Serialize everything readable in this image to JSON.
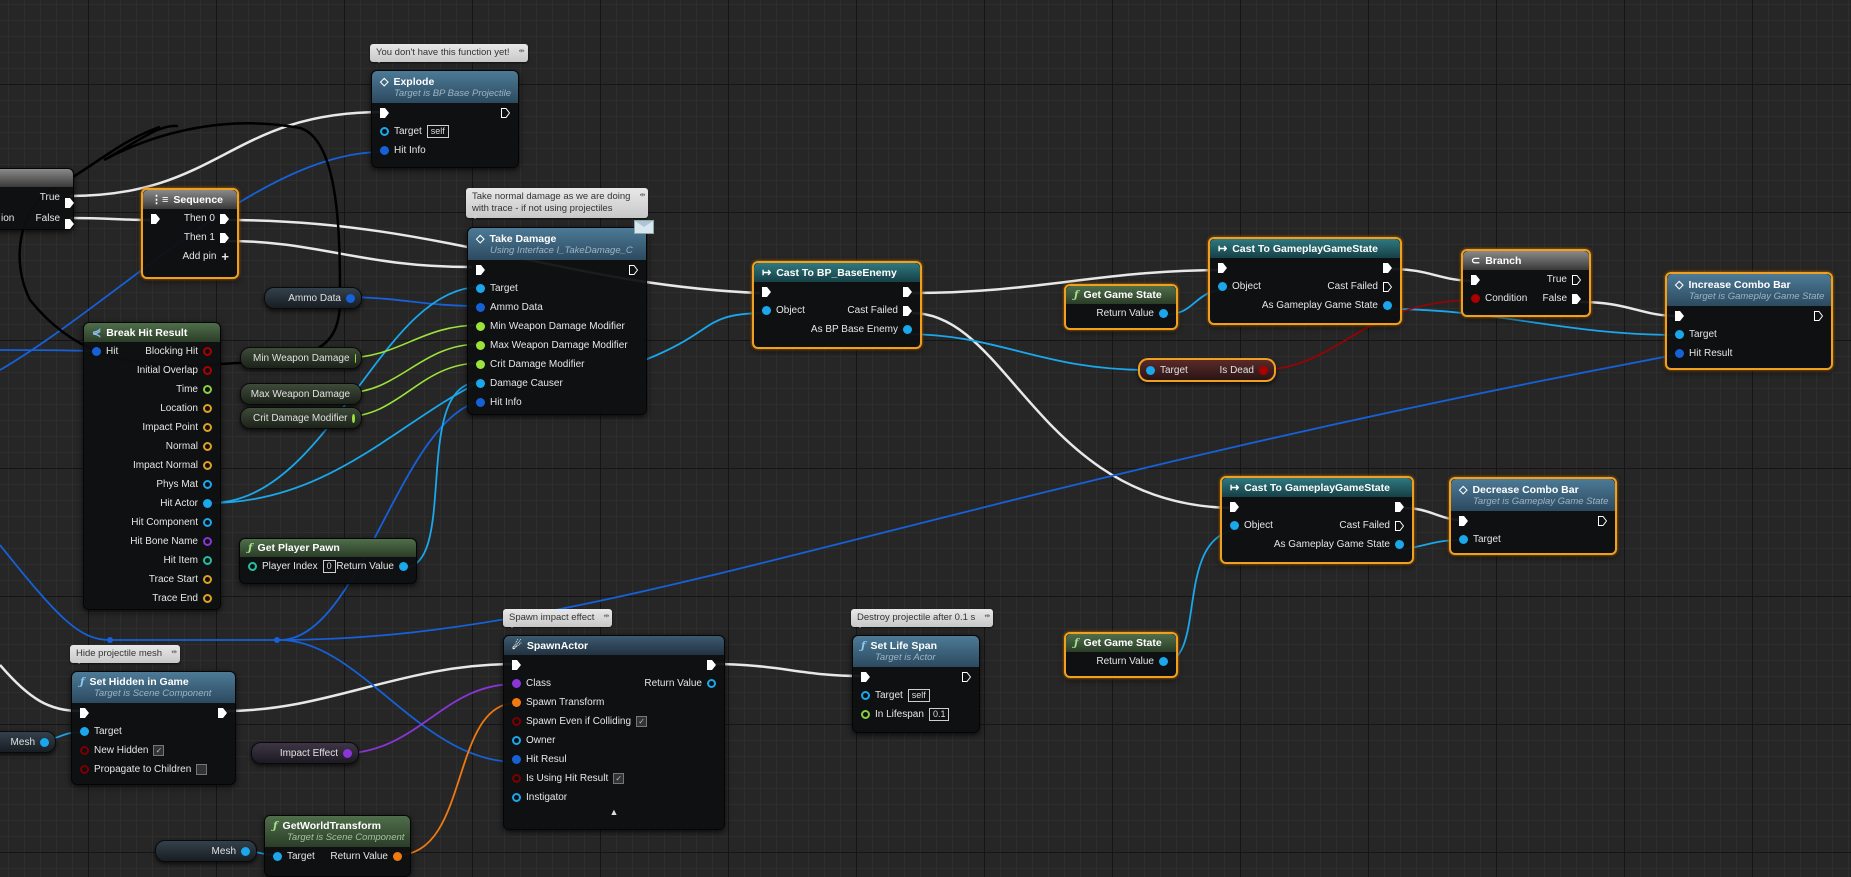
{
  "app": "Unreal Engine Blueprint Graph Editor",
  "colors": {
    "exec": "#ffffff",
    "object": "#1aa7ec",
    "struct": "#1660d8",
    "float": "#9be33a",
    "bool": "#a00000",
    "vector": "#e0a020",
    "class": "#8a35d8",
    "transform": "#f07a10",
    "selection": "#f0a020"
  },
  "comments": {
    "explode": "You don't have this function yet!",
    "take_damage": [
      "Take normal damage as we are doing",
      "with trace - if not using projectiles"
    ],
    "hide_mesh": "Hide projectile mesh",
    "spawn": "Spawn impact effect",
    "destroy": "Destroy projectile after 0.1 s"
  },
  "nodes": {
    "partial_branch": {
      "true": "True",
      "false": "False",
      "condition_fragment": "ion"
    },
    "sequence": {
      "title": "Sequence",
      "then0": "Then 0",
      "then1": "Then 1",
      "add_pin": "Add pin"
    },
    "explode": {
      "title": "Explode",
      "subtitle": "Target is BP Base Projectile",
      "target": "Target",
      "target_default": "self",
      "hit_info": "Hit Info"
    },
    "take_damage": {
      "title": "Take Damage",
      "subtitle": "Using Interface I_TakeDamage_C",
      "pins": [
        "Target",
        "Ammo Data",
        "Min Weapon Damage Modifier",
        "Max Weapon Damage Modifier",
        "Crit Damage Modifier",
        "Damage Causer",
        "Hit Info"
      ]
    },
    "break_hit_result": {
      "title": "Break Hit Result",
      "input": "Hit",
      "outputs": [
        "Blocking Hit",
        "Initial Overlap",
        "Time",
        "Location",
        "Impact Point",
        "Normal",
        "Impact Normal",
        "Phys Mat",
        "Hit Actor",
        "Hit Component",
        "Hit Bone Name",
        "Hit Item",
        "Trace Start",
        "Trace End"
      ]
    },
    "get_player_pawn": {
      "title": "Get Player Pawn",
      "player_index": "Player Index",
      "player_index_value": "0",
      "return_value": "Return Value"
    },
    "cast_base_enemy": {
      "title": "Cast To BP_BaseEnemy",
      "object": "Object",
      "cast_failed": "Cast Failed",
      "as": "As BP Base Enemy"
    },
    "get_game_state_1": {
      "title": "Get Game State",
      "return_value": "Return Value"
    },
    "cast_game_state_1": {
      "title": "Cast To GameplayGameState",
      "object": "Object",
      "cast_failed": "Cast Failed",
      "as": "As Gameplay Game State"
    },
    "is_dead": {
      "target": "Target",
      "label": "Is Dead"
    },
    "branch": {
      "title": "Branch",
      "true": "True",
      "false": "False",
      "condition": "Condition"
    },
    "increase_combo": {
      "title": "Increase Combo Bar",
      "subtitle": "Target is Gameplay Game State",
      "target": "Target",
      "hit_result": "Hit Result"
    },
    "cast_game_state_2": {
      "title": "Cast To GameplayGameState",
      "object": "Object",
      "cast_failed": "Cast Failed",
      "as": "As Gameplay Game State"
    },
    "decrease_combo": {
      "title": "Decrease Combo Bar",
      "subtitle": "Target is Gameplay Game State",
      "target": "Target"
    },
    "get_game_state_2": {
      "title": "Get Game State",
      "return_value": "Return Value"
    },
    "set_hidden": {
      "title": "Set Hidden in Game",
      "subtitle": "Target is Scene Component",
      "target": "Target",
      "new_hidden": "New Hidden",
      "new_hidden_checked": true,
      "propagate": "Propagate to Children",
      "propagate_checked": false
    },
    "spawn_actor": {
      "title": "SpawnActor",
      "class": "Class",
      "return_value": "Return Value",
      "spawn_transform": "Spawn Transform",
      "spawn_even": "Spawn Even if Colliding",
      "owner": "Owner",
      "hit_resul": "Hit Resul",
      "is_using": "Is Using Hit Result",
      "instigator": "Instigator"
    },
    "set_life_span": {
      "title": "Set Life Span",
      "subtitle": "Target is Actor",
      "target": "Target",
      "target_default": "self",
      "lifespan": "In Lifespan",
      "lifespan_value": "0.1"
    },
    "get_world_transform": {
      "title": "GetWorldTransform",
      "subtitle": "Target is Scene Component",
      "target": "Target",
      "return_value": "Return Value"
    }
  },
  "variables": {
    "ammo_data": "Ammo Data",
    "min_weapon_damage": "Min Weapon Damage",
    "max_weapon_damage": "Max Weapon Damage",
    "crit_damage_modifier": "Crit Damage Modifier",
    "impact_effect": "Impact Effect",
    "mesh_1": "Mesh",
    "mesh_2": "Mesh"
  }
}
